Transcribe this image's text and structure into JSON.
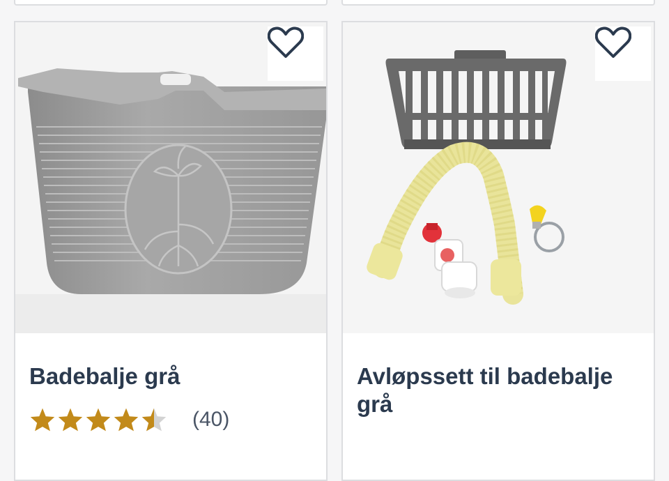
{
  "products": [
    {
      "title": "Badebalje grå",
      "rating": 4.5,
      "rating_max": 5,
      "review_count": "(40)",
      "favorite_icon": "heart-outline-icon",
      "image": "grey-plastic-bathtub"
    },
    {
      "title": "Avløpssett til badebalje grå",
      "favorite_icon": "heart-outline-icon",
      "image": "drain-kit-basket-hose"
    }
  ],
  "colors": {
    "title": "#2b3a4e",
    "star_filled": "#c28a1a",
    "star_empty": "#d3d3d3",
    "card_border": "#dcdde0"
  }
}
